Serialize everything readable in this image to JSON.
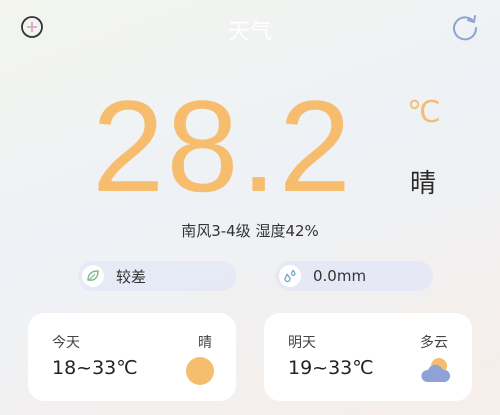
{
  "header": {
    "title": "天气",
    "add_icon": "add-circle-icon",
    "refresh_icon": "refresh-icon"
  },
  "current": {
    "temperature": "28.2",
    "unit": "℃",
    "condition": "晴",
    "wind_humidity": "南风3-4级 湿度42%"
  },
  "indicators": [
    {
      "icon": "leaf-icon",
      "label": "较差"
    },
    {
      "icon": "raindrops-icon",
      "label": "0.0mm"
    }
  ],
  "forecast": [
    {
      "day": "今天",
      "condition": "晴",
      "range": "18~33℃",
      "icon": "sun-icon"
    },
    {
      "day": "明天",
      "condition": "多云",
      "range": "19~33℃",
      "icon": "cloudy-icon"
    }
  ],
  "colors": {
    "accent": "#f6bd6f",
    "sun": "#f6bd6f",
    "cloud": "#8fa2d8",
    "pill": "#e4e8f6"
  }
}
